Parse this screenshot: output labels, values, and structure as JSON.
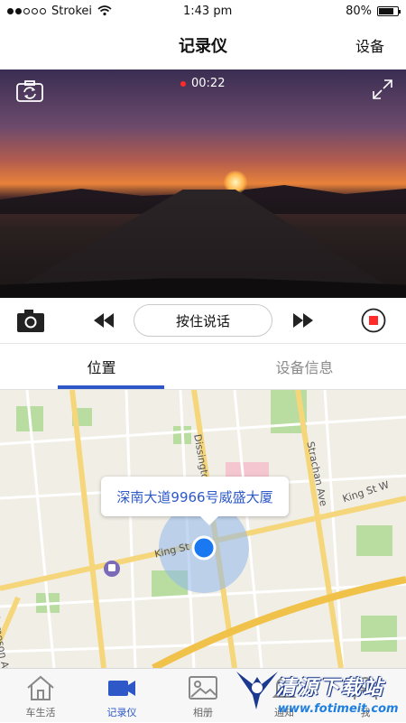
{
  "status_bar": {
    "carrier": "Strokei",
    "time": "1:43 pm",
    "battery": "80%",
    "battery_level": 0.8
  },
  "nav": {
    "title": "记录仪",
    "right_button": "设备"
  },
  "video": {
    "rec_time": "00:22"
  },
  "controls": {
    "talk_button": "按住说话"
  },
  "tabs": [
    {
      "label": "位置",
      "active": true
    },
    {
      "label": "设备信息",
      "active": false
    }
  ],
  "map": {
    "callout": "深南大道9966号威盛大厦",
    "streets": [
      "Dissington Ave",
      "Strachan Ave",
      "King St W",
      "King St",
      "Jameson Ave"
    ]
  },
  "tabbar": {
    "items": [
      {
        "label": "车生活",
        "icon": "home-icon",
        "active": false
      },
      {
        "label": "记录仪",
        "icon": "video-camera-icon",
        "active": true
      },
      {
        "label": "相册",
        "icon": "photo-icon",
        "active": false
      },
      {
        "label": "通知",
        "icon": "bell-icon",
        "active": false
      },
      {
        "label": "我",
        "icon": "user-icon",
        "active": false
      }
    ]
  },
  "watermark": {
    "title": "清源下载站",
    "url": "www.fotimeit.com"
  },
  "colors": {
    "accent": "#2e58c8",
    "record": "#ff2a2a"
  }
}
